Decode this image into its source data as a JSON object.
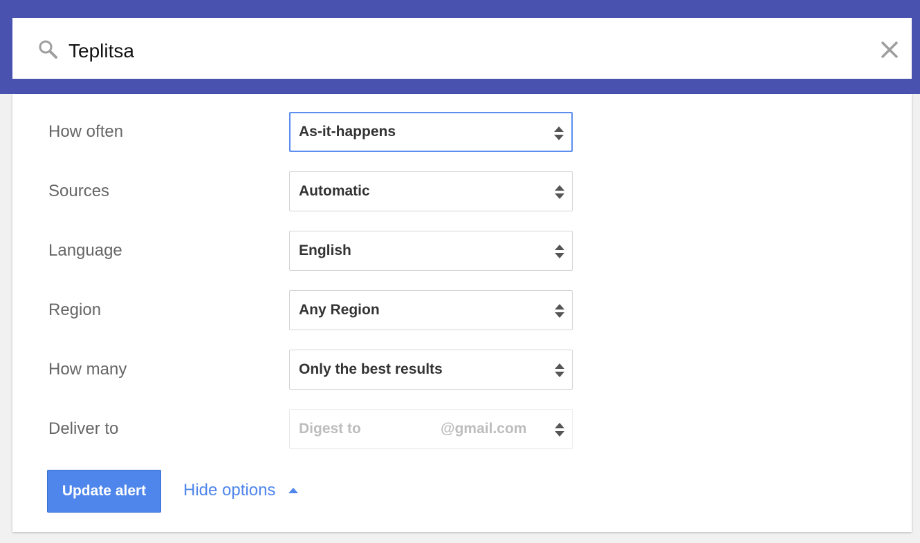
{
  "search": {
    "query": "Teplitsa",
    "search_icon": "search-icon",
    "close_icon": "close-icon"
  },
  "options": [
    {
      "label": "How often",
      "value": "As-it-happens",
      "focused": true
    },
    {
      "label": "Sources",
      "value": "Automatic"
    },
    {
      "label": "Language",
      "value": "English"
    },
    {
      "label": "Region",
      "value": "Any Region"
    },
    {
      "label": "How many",
      "value": "Only the best results"
    },
    {
      "label": "Deliver to",
      "value_prefix": "Digest to",
      "value_suffix": "@gmail.com",
      "disabled": true
    }
  ],
  "actions": {
    "update_label": "Update alert",
    "hide_options_label": "Hide options",
    "caret_icon": "caret-up-icon"
  },
  "colors": {
    "header": "#4a52b0",
    "accent": "#4f86ec",
    "focus_border": "#5b8ef0"
  }
}
